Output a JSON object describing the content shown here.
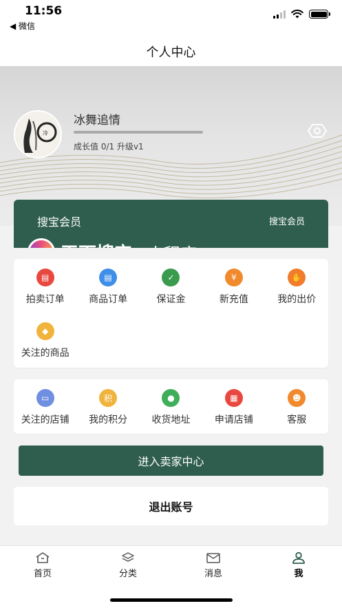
{
  "status": {
    "time": "11:56",
    "back_label": "◀ 微信"
  },
  "nav": {
    "title": "个人中心"
  },
  "profile": {
    "username": "冰舞追情",
    "growth_text": "成长值 0/1 升级v1",
    "progress": 0.0
  },
  "member": {
    "title": "搜宝会员",
    "link": "搜宝会员",
    "promo_text": "天下搜宝",
    "promo_suffix": "小程序"
  },
  "orders": [
    {
      "label": "拍卖订单",
      "icon": "auction-order-icon",
      "color": "#e8483f"
    },
    {
      "label": "商品订单",
      "icon": "goods-order-icon",
      "color": "#3f8ee8"
    },
    {
      "label": "保证金",
      "icon": "deposit-shield-icon",
      "color": "#3a9a4e"
    },
    {
      "label": "新充值",
      "icon": "recharge-yen-icon",
      "color": "#f08a2c"
    },
    {
      "label": "我的出价",
      "icon": "bid-hand-icon",
      "color": "#f07c2c"
    },
    {
      "label": "关注的商品",
      "icon": "followed-goods-icon",
      "color": "#f0b43c"
    }
  ],
  "services": [
    {
      "label": "关注的店铺",
      "icon": "followed-store-icon",
      "color": "#6f8fe0"
    },
    {
      "label": "我的积分",
      "icon": "points-icon",
      "color": "#f0b43c"
    },
    {
      "label": "收货地址",
      "icon": "location-pin-icon",
      "color": "#3fae5a"
    },
    {
      "label": "申请店铺",
      "icon": "apply-store-icon",
      "color": "#e8483f"
    },
    {
      "label": "客服",
      "icon": "customer-service-icon",
      "color": "#f08a2c"
    }
  ],
  "actions": {
    "seller_center": "进入卖家中心",
    "logout": "退出账号"
  },
  "tabs": [
    {
      "label": "首页",
      "icon": "home-icon"
    },
    {
      "label": "分类",
      "icon": "category-layers-icon"
    },
    {
      "label": "消息",
      "icon": "message-mail-icon"
    },
    {
      "label": "我",
      "icon": "user-icon"
    }
  ]
}
